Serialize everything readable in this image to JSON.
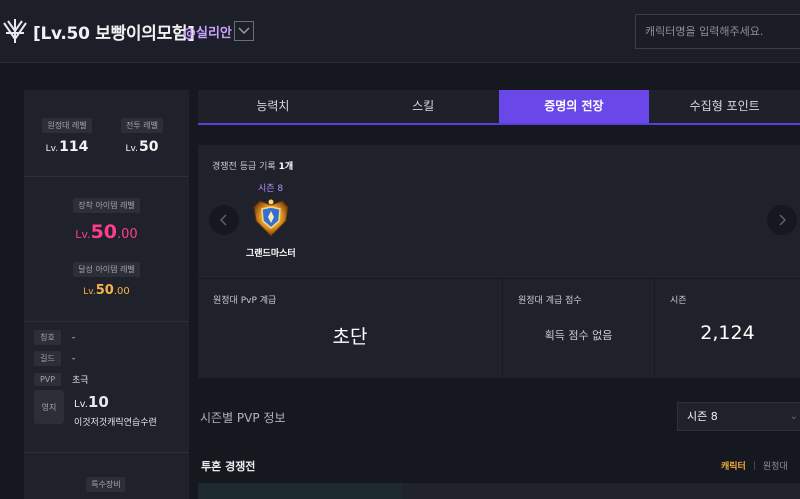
{
  "header": {
    "title": "[Lv.50 보빵이의모험]",
    "server": "@실리안",
    "search_placeholder": "캐릭터명을 입력해주세요."
  },
  "profile": {
    "expedition_label": "원정대 레벨",
    "expedition_prefix": "Lv.",
    "expedition_level": "114",
    "combat_label": "전투 레벨",
    "combat_prefix": "Lv.",
    "combat_level": "50",
    "equip_label": "장착 아이템 레벨",
    "equip_prefix": "Lv.",
    "equip_int": "50",
    "equip_dec": ".00",
    "achieved_label": "달성 아이템 레벨",
    "achieved_prefix": "Lv.",
    "achieved_int": "50",
    "achieved_dec": ".00",
    "title_label": "칭호",
    "title_value": "-",
    "guild_label": "길드",
    "guild_value": "-",
    "pvp_label": "PVP",
    "pvp_value": "초극",
    "estate_label": "영지",
    "estate_prefix": "Lv.",
    "estate_level": "10",
    "estate_name": "이것저것캐릭연습수련",
    "special_label": "특수장비"
  },
  "tabs": [
    "능력치",
    "스킬",
    "증명의 전장",
    "수집형 포인트"
  ],
  "active_tab": 2,
  "proof": {
    "record_label": "경쟁전 등급 기록",
    "record_count": "1개",
    "season": "시즌 8",
    "rank": "그랜드마스터"
  },
  "stats": {
    "pvp_grade_label": "원정대 PvP 계급",
    "pvp_grade_value": "초단",
    "grade_score_label": "원정대 계급 점수",
    "grade_score_value": "획득 점수 없음",
    "season_label": "시즌",
    "season_value": "2,124"
  },
  "season_pvp": {
    "title": "시즌별 PVP 정보",
    "selected": "시즌 8"
  },
  "duel": {
    "title": "투혼 경쟁전",
    "tab_character": "캐릭터",
    "tab_expedition": "원정대"
  },
  "colors": {
    "accent_purple": "#6a47e8",
    "item_level_pink": "#ff3d8d",
    "achieved_orange": "#f6b34a",
    "server_violet": "#c8a0ff"
  },
  "icons": {
    "logo": "crest-logo-icon",
    "dropdown": "chevron-down-icon",
    "medal": "grandmaster-medal-icon",
    "prev": "chevron-left-icon",
    "next": "chevron-right-icon"
  }
}
